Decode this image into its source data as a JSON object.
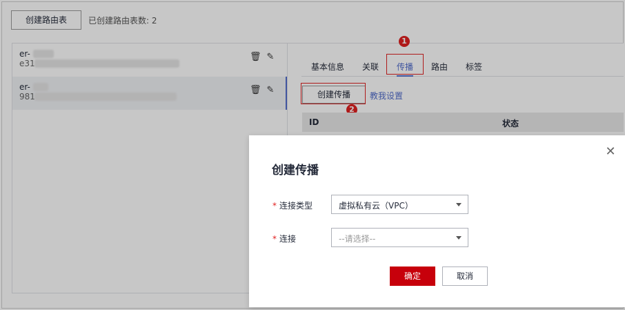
{
  "header": {
    "create_route_table_label": "创建路由表",
    "route_table_count": "已创建路由表数: 2"
  },
  "route_tables": [
    {
      "name": "er-",
      "id": "e31"
    },
    {
      "name": "er-",
      "id": "981"
    }
  ],
  "tabs": [
    {
      "label": "基本信息"
    },
    {
      "label": "关联"
    },
    {
      "label": "传播"
    },
    {
      "label": "路由"
    },
    {
      "label": "标签"
    }
  ],
  "markers": {
    "step1": "1",
    "step2": "2"
  },
  "toolbar": {
    "create_propagation_label": "创建传播",
    "help_link": "教我设置"
  },
  "table": {
    "columns": [
      "ID",
      "状态"
    ]
  },
  "dialog": {
    "title": "创建传播",
    "close_icon": "close-icon",
    "fields": [
      {
        "label": "连接类型",
        "value": "虚拟私有云（VPC）"
      },
      {
        "label": "连接",
        "placeholder": "--请选择--"
      }
    ],
    "required_mark": "*",
    "ok_label": "确定",
    "cancel_label": "取消"
  },
  "colors": {
    "accent": "#526ecc",
    "primary_button": "#c7000b",
    "highlight": "#e02020"
  }
}
